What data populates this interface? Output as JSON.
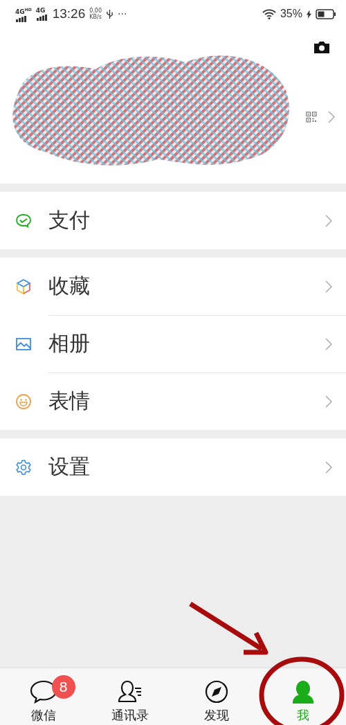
{
  "status_bar": {
    "network_1": "4G",
    "network_1_tag": "HD",
    "network_2": "4G",
    "time": "13:26",
    "speed": "0.00",
    "speed_unit": "KB/s",
    "more": "···",
    "battery": "35%",
    "charging": true
  },
  "sections": [
    {
      "items": [
        {
          "label": "支付",
          "kind": "pay"
        }
      ]
    },
    {
      "items": [
        {
          "label": "收藏",
          "kind": "favorites"
        },
        {
          "label": "相册",
          "kind": "album"
        },
        {
          "label": "表情",
          "kind": "sticker"
        }
      ]
    },
    {
      "items": [
        {
          "label": "设置",
          "kind": "settings"
        }
      ]
    }
  ],
  "tabs": [
    {
      "label": "微信",
      "kind": "chats",
      "selected": false,
      "badge": "8"
    },
    {
      "label": "通讯录",
      "kind": "contacts",
      "selected": false
    },
    {
      "label": "发现",
      "kind": "discover",
      "selected": false
    },
    {
      "label": "我",
      "kind": "me",
      "selected": true
    }
  ]
}
